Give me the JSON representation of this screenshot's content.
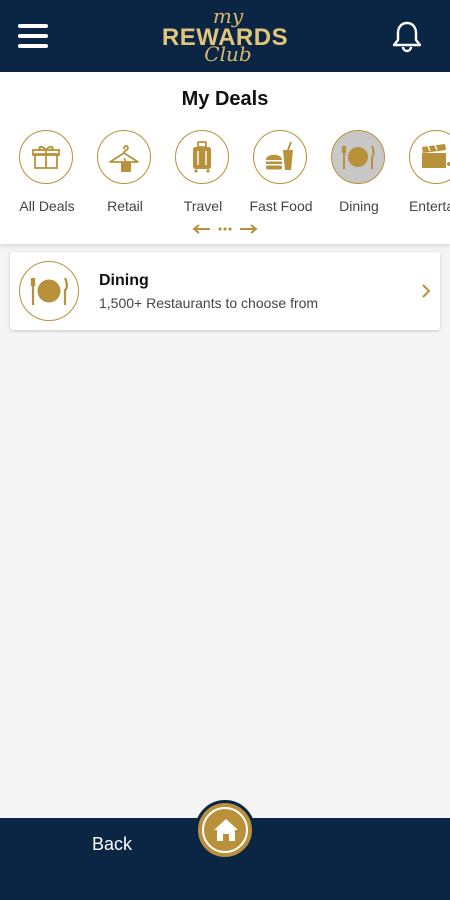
{
  "app": {
    "logo": {
      "line1": "my",
      "line2": "REWARDS",
      "line3": "Club"
    },
    "icons": {
      "menu": "hamburger-menu-icon",
      "notifications": "bell-icon"
    }
  },
  "page": {
    "title": "My Deals"
  },
  "categories": [
    {
      "label": "All Deals",
      "icon": "gift-icon",
      "active": false
    },
    {
      "label": "Retail",
      "icon": "hanger-tag-icon",
      "active": false
    },
    {
      "label": "Travel",
      "icon": "suitcase-icon",
      "active": false
    },
    {
      "label": "Fast Food",
      "icon": "burger-drink-icon",
      "active": false
    },
    {
      "label": "Dining",
      "icon": "plate-cutlery-icon",
      "active": true
    },
    {
      "label": "Entertain",
      "icon": "clapperboard-icon",
      "active": false
    }
  ],
  "deals": [
    {
      "title": "Dining",
      "subtitle": "1,500+ Restaurants to choose from",
      "icon": "plate-cutlery-icon"
    }
  ],
  "footer": {
    "back_label": "Back",
    "home_icon": "home-icon"
  },
  "colors": {
    "navy": "#0b2545",
    "gold": "#b8913a",
    "background": "#f4f4f4"
  }
}
